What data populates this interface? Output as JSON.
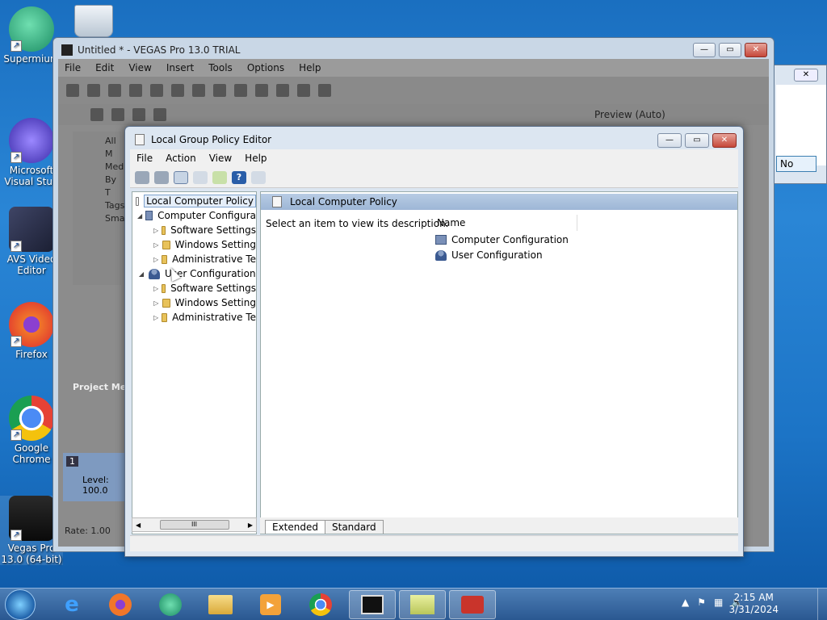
{
  "desktop": {
    "icons": [
      {
        "label": "Supermium",
        "color": "#2aa57a"
      },
      {
        "label": "Microsoft Visual Stud",
        "color": "#5b5bd1"
      },
      {
        "label": "AVS Video Editor",
        "color": "#343a58"
      },
      {
        "label": "Firefox",
        "color": "#e86a1e"
      },
      {
        "label": "Google Chrome",
        "color": "#3b7fe2"
      },
      {
        "label": "Vegas Pro 13.0 (64-bit)",
        "color": "#1c1c1c"
      }
    ]
  },
  "vegas": {
    "title": "Untitled * - VEGAS Pro 13.0 TRIAL",
    "menu": [
      "File",
      "Edit",
      "View",
      "Insert",
      "Tools",
      "Options",
      "Help"
    ],
    "preview_label": "Preview (Auto)",
    "tree": [
      "All M",
      "Med",
      "By T",
      "Tags",
      "Sma"
    ],
    "project_media": "Project Med",
    "level": "Level: 100.0",
    "track_no": "1",
    "rate": "Rate: 1.00"
  },
  "dialog_button": "No",
  "gpedit": {
    "title": "Local Group Policy Editor",
    "menu": [
      "File",
      "Action",
      "View",
      "Help"
    ],
    "tree": [
      {
        "label": "Local Computer Policy"
      },
      {
        "label": "Computer Configura"
      },
      {
        "label": "Software Settings"
      },
      {
        "label": "Windows Setting"
      },
      {
        "label": "Administrative Te"
      },
      {
        "label": "User Configuration"
      },
      {
        "label": "Software Settings"
      },
      {
        "label": "Windows Setting"
      },
      {
        "label": "Administrative Te"
      }
    ],
    "scroll_thumb": "III",
    "header": "Local Computer Policy",
    "description": "Select an item to view its description.",
    "column_name": "Name",
    "items": [
      "Computer Configuration",
      "User Configuration"
    ],
    "tabs": [
      "Extended",
      "Standard"
    ]
  },
  "taskbar": {
    "time": "2:15 AM",
    "date": "3/31/2024",
    "colors": {
      "accent": "#2a5891",
      "highlight": "#ffffff"
    }
  }
}
